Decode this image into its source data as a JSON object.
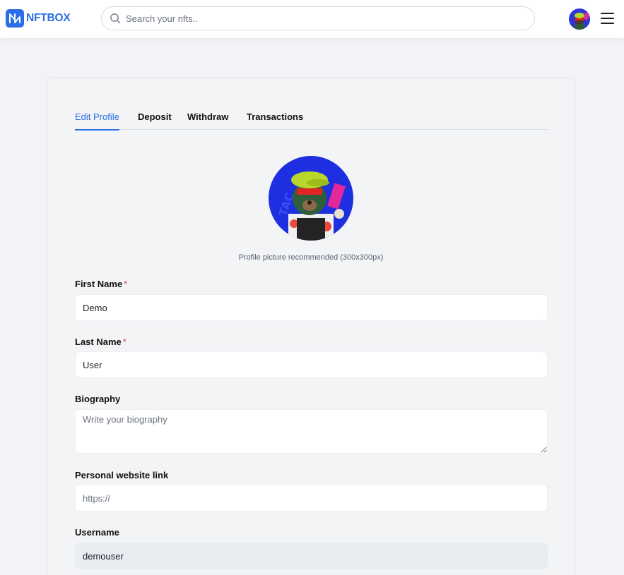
{
  "brand": {
    "part1": "NFT",
    "part2": "BOX",
    "accent": "#2b6ee8"
  },
  "search": {
    "placeholder": "Search your nfts..",
    "value": ""
  },
  "header": {
    "avatar_icon": "user-avatar",
    "menu_icon": "hamburger-menu-icon"
  },
  "tabs": [
    {
      "label": "Edit Profile",
      "active": true
    },
    {
      "label": "Deposit",
      "active": false
    },
    {
      "label": "Withdraw",
      "active": false
    },
    {
      "label": "Transactions",
      "active": false
    }
  ],
  "profile": {
    "picture_hint": "Profile picture recommended (300x300px)"
  },
  "form": {
    "first_name": {
      "label": "First Name",
      "required_mark": "*",
      "value": "Demo"
    },
    "last_name": {
      "label": "Last Name",
      "required_mark": "*",
      "value": "User"
    },
    "biography": {
      "label": "Biography",
      "placeholder": "Write your biography",
      "value": ""
    },
    "website": {
      "label": "Personal website link",
      "placeholder": "https://",
      "value": ""
    },
    "username": {
      "label": "Username",
      "value": "demouser"
    }
  }
}
